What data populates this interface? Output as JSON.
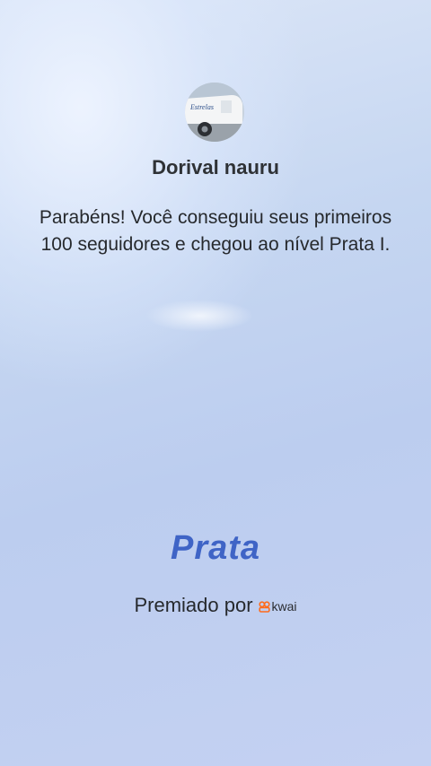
{
  "profile": {
    "username": "Dorival nauru",
    "avatar_icon": "van-photo-avatar"
  },
  "message": "Parabéns! Você conseguiu seus primeiros 100 seguidores e chegou ao nível Prata I.",
  "level": {
    "title": "Prata",
    "color": "#3f64c6"
  },
  "award": {
    "label": "Premiado por",
    "brand_name": "kwai",
    "brand_icon": "kwai-logo-icon",
    "brand_color": "#ff6a1a"
  }
}
